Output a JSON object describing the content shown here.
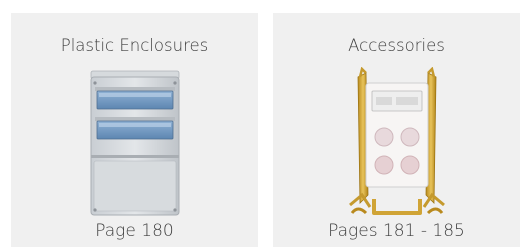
{
  "cards": [
    {
      "title": "Plastic Enclosures",
      "page": "Page 180",
      "image_icon": "plastic-enclosure-image"
    },
    {
      "title": "Accessories",
      "page": "Pages 181 - 185",
      "image_icon": "accessory-frame-image"
    }
  ]
}
